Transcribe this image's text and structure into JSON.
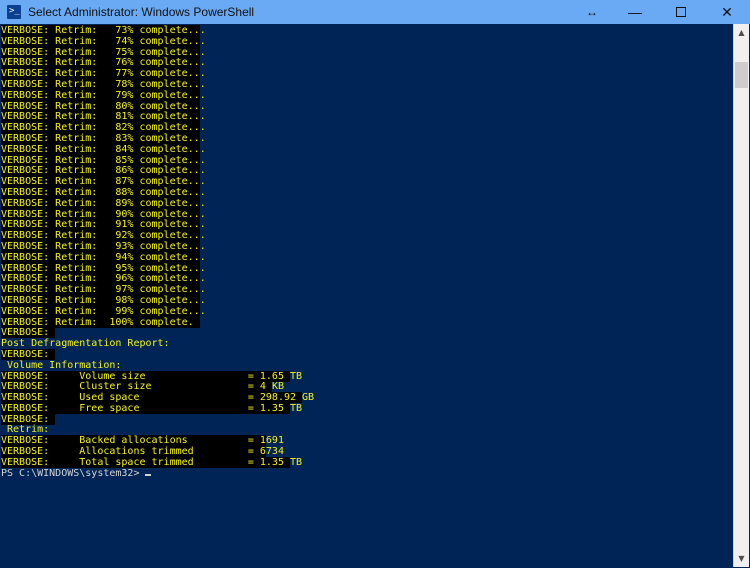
{
  "window": {
    "title": "Select Administrator: Windows PowerShell",
    "icon": "powershell-icon",
    "icon_glyph": ">_",
    "titlebar_color": "#6aaaf5",
    "console_bg": "#012456",
    "verbose_fg": "#f3f31c",
    "verbose_bg": "#000000",
    "prompt_fg": "#d4d4d4"
  },
  "titlebar_buttons": {
    "resize": "↔",
    "minimize": "—",
    "maximize": "□",
    "close": "✕"
  },
  "scrollbar": {
    "up_arrow": "▲",
    "down_arrow": "▼"
  },
  "console": {
    "lines": [
      {
        "text": "VERBOSE: Retrim:   73% complete...",
        "style": "warn",
        "black_cols": 33
      },
      {
        "text": "VERBOSE: Retrim:   74% complete...",
        "style": "warn",
        "black_cols": 33
      },
      {
        "text": "VERBOSE: Retrim:   75% complete...",
        "style": "warn",
        "black_cols": 33
      },
      {
        "text": "VERBOSE: Retrim:   76% complete...",
        "style": "warn",
        "black_cols": 33
      },
      {
        "text": "VERBOSE: Retrim:   77% complete...",
        "style": "warn",
        "black_cols": 33
      },
      {
        "text": "VERBOSE: Retrim:   78% complete...",
        "style": "warn",
        "black_cols": 33
      },
      {
        "text": "VERBOSE: Retrim:   79% complete...",
        "style": "warn",
        "black_cols": 33
      },
      {
        "text": "VERBOSE: Retrim:   80% complete...",
        "style": "warn",
        "black_cols": 33
      },
      {
        "text": "VERBOSE: Retrim:   81% complete...",
        "style": "warn",
        "black_cols": 33
      },
      {
        "text": "VERBOSE: Retrim:   82% complete...",
        "style": "warn",
        "black_cols": 33
      },
      {
        "text": "VERBOSE: Retrim:   83% complete...",
        "style": "warn",
        "black_cols": 33
      },
      {
        "text": "VERBOSE: Retrim:   84% complete...",
        "style": "warn",
        "black_cols": 33
      },
      {
        "text": "VERBOSE: Retrim:   85% complete...",
        "style": "warn",
        "black_cols": 33
      },
      {
        "text": "VERBOSE: Retrim:   86% complete...",
        "style": "warn",
        "black_cols": 33
      },
      {
        "text": "VERBOSE: Retrim:   87% complete...",
        "style": "warn",
        "black_cols": 33
      },
      {
        "text": "VERBOSE: Retrim:   88% complete...",
        "style": "warn",
        "black_cols": 33
      },
      {
        "text": "VERBOSE: Retrim:   89% complete...",
        "style": "warn",
        "black_cols": 33
      },
      {
        "text": "VERBOSE: Retrim:   90% complete...",
        "style": "warn",
        "black_cols": 33
      },
      {
        "text": "VERBOSE: Retrim:   91% complete...",
        "style": "warn",
        "black_cols": 33
      },
      {
        "text": "VERBOSE: Retrim:   92% complete...",
        "style": "warn",
        "black_cols": 33
      },
      {
        "text": "VERBOSE: Retrim:   93% complete...",
        "style": "warn",
        "black_cols": 33
      },
      {
        "text": "VERBOSE: Retrim:   94% complete...",
        "style": "warn",
        "black_cols": 33
      },
      {
        "text": "VERBOSE: Retrim:   95% complete...",
        "style": "warn",
        "black_cols": 33
      },
      {
        "text": "VERBOSE: Retrim:   96% complete...",
        "style": "warn",
        "black_cols": 33
      },
      {
        "text": "VERBOSE: Retrim:   97% complete...",
        "style": "warn",
        "black_cols": 33
      },
      {
        "text": "VERBOSE: Retrim:   98% complete...",
        "style": "warn",
        "black_cols": 33
      },
      {
        "text": "VERBOSE: Retrim:   99% complete...",
        "style": "warn",
        "black_cols": 33
      },
      {
        "text": "VERBOSE: Retrim:  100% complete.",
        "style": "warn",
        "black_cols": 33
      },
      {
        "text": "VERBOSE: ",
        "style": "warn",
        "black_cols": 9
      },
      {
        "text": "Post Defragmentation Report:",
        "style": "warn",
        "black_cols": 0
      },
      {
        "text": "VERBOSE: ",
        "style": "warn",
        "black_cols": 9
      },
      {
        "text": " Volume Information:",
        "style": "warn",
        "black_cols": 0
      },
      {
        "text": "VERBOSE:     Volume size                 = 1.65 TB",
        "style": "warn",
        "black_cols": 48
      },
      {
        "text": "VERBOSE:     Cluster size                = 4 KB",
        "style": "warn",
        "black_cols": 45
      },
      {
        "text": "VERBOSE:     Used space                  = 298.92 GB",
        "style": "warn",
        "black_cols": 50
      },
      {
        "text": "VERBOSE:     Free space                  = 1.35 TB",
        "style": "warn",
        "black_cols": 48
      },
      {
        "text": "VERBOSE: ",
        "style": "warn",
        "black_cols": 9
      },
      {
        "text": " Retrim:",
        "style": "warn",
        "black_cols": 0
      },
      {
        "text": "VERBOSE:     Backed allocations          = 1691",
        "style": "warn",
        "black_cols": 44
      },
      {
        "text": "VERBOSE:     Allocations trimmed         = 6734",
        "style": "warn",
        "black_cols": 44
      },
      {
        "text": "VERBOSE:     Total space trimmed         = 1.35 TB",
        "style": "warn",
        "black_cols": 48
      }
    ],
    "prompt": "PS C:\\WINDOWS\\system32>",
    "prompt_cursor": "_"
  }
}
